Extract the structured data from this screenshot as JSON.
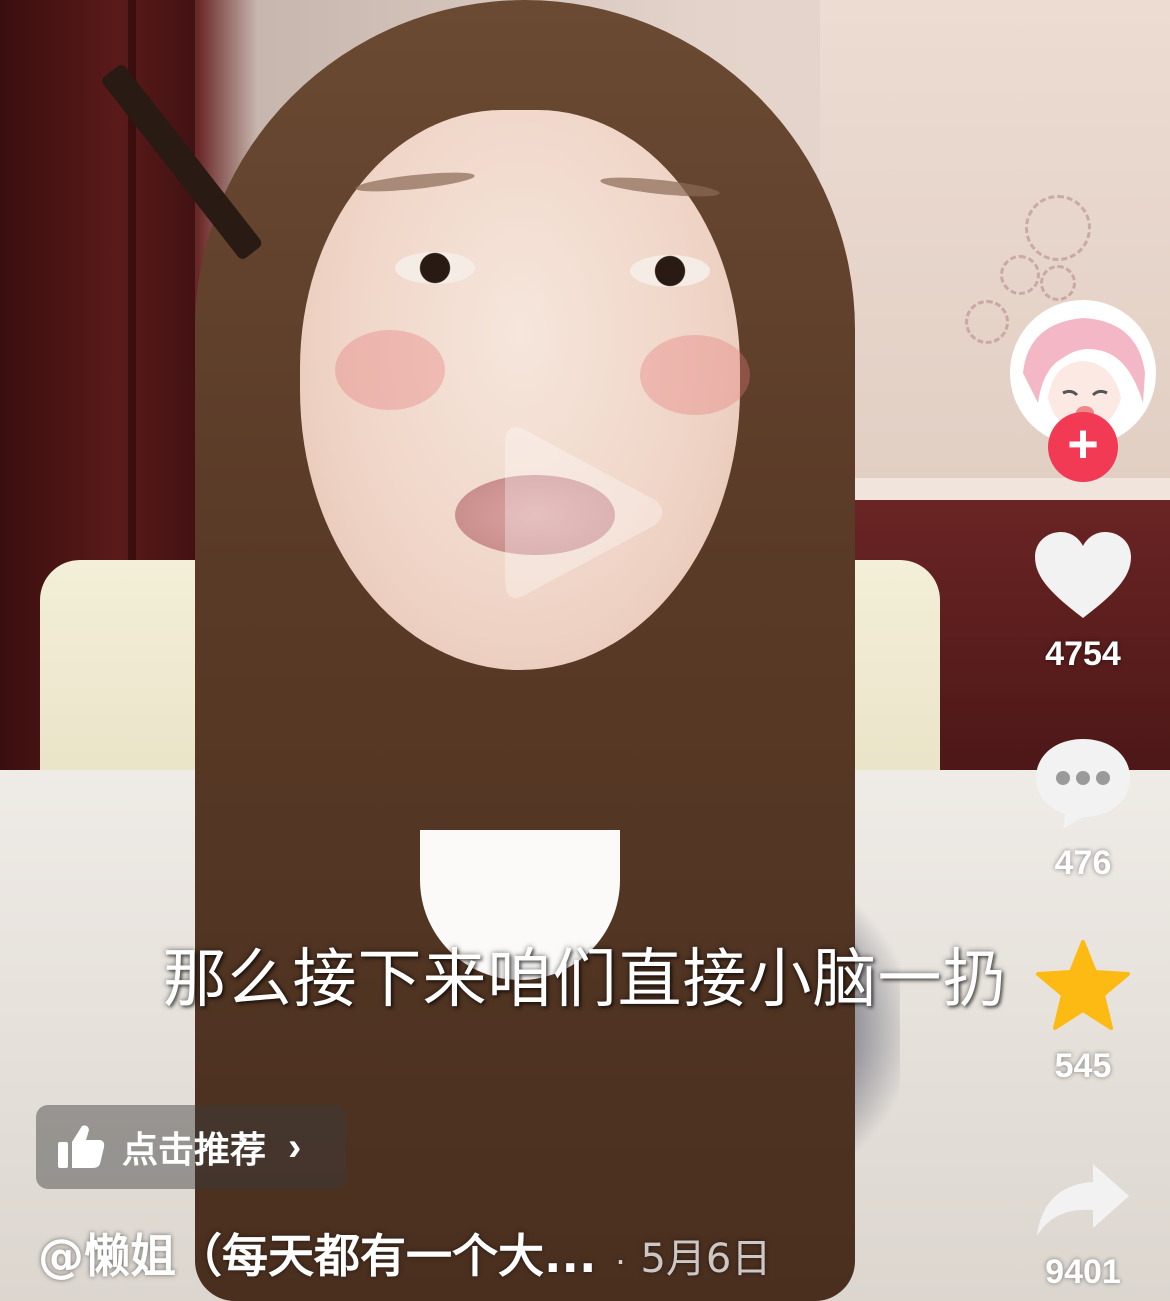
{
  "subtitle": "那么接下来咱们直接小脑一扔",
  "author": {
    "name": "@懒姐（每天都有一个大...",
    "separator": "·",
    "date": "5月6日",
    "follow_symbol": "+"
  },
  "actions": {
    "like_count": "4754",
    "comment_count": "476",
    "favorite_count": "545",
    "share_count": "9401"
  },
  "recommend": {
    "label": "点击推荐",
    "chevron": "›"
  },
  "icons": {
    "play": "play-icon",
    "like": "heart-icon",
    "comment": "comment-icon",
    "favorite": "star-icon",
    "share": "share-icon",
    "recommend": "thumbs-up-icon"
  },
  "colors": {
    "favorite_active": "#FDBA12",
    "follow_button": "#F23A55",
    "icon_white": "#F2F2F2"
  }
}
